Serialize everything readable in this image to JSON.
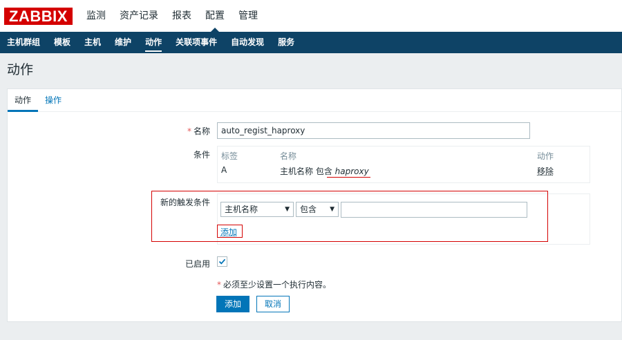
{
  "header": {
    "logo": "ZABBIX",
    "menu": [
      {
        "label": "监测"
      },
      {
        "label": "资产记录"
      },
      {
        "label": "报表"
      },
      {
        "label": "配置"
      },
      {
        "label": "管理"
      }
    ],
    "active_menu": "配置"
  },
  "submenu": {
    "items": [
      {
        "label": "主机群组"
      },
      {
        "label": "模板"
      },
      {
        "label": "主机"
      },
      {
        "label": "维护"
      },
      {
        "label": "动作"
      },
      {
        "label": "关联项事件"
      },
      {
        "label": "自动发现"
      },
      {
        "label": "服务"
      }
    ],
    "active": "动作"
  },
  "page": {
    "title": "动作"
  },
  "tabs": [
    {
      "label": "动作"
    },
    {
      "label": "操作"
    }
  ],
  "form": {
    "name_required_mark": "*",
    "name_label": "名称",
    "name_value": "auto_regist_haproxy",
    "conditions_label": "条件",
    "conditions_headers": {
      "label": "标签",
      "name": "名称",
      "action": "动作"
    },
    "conditions": [
      {
        "label": "A",
        "name_prefix": "主机名称 包含",
        "name_value": "haproxy",
        "action": "移除"
      }
    ],
    "new_condition_label": "新的触发条件",
    "new_condition": {
      "type_select": "主机名称",
      "operator_select": "包含",
      "value": "",
      "add_link": "添加"
    },
    "enabled_label": "已启用",
    "enabled": true,
    "note_mark": "*",
    "note": "必须至少设置一个执行内容。",
    "submit_label": "添加",
    "cancel_label": "取消"
  },
  "colors": {
    "brand": "#d40000",
    "nav": "#0e4366",
    "accent": "#0275b8"
  }
}
